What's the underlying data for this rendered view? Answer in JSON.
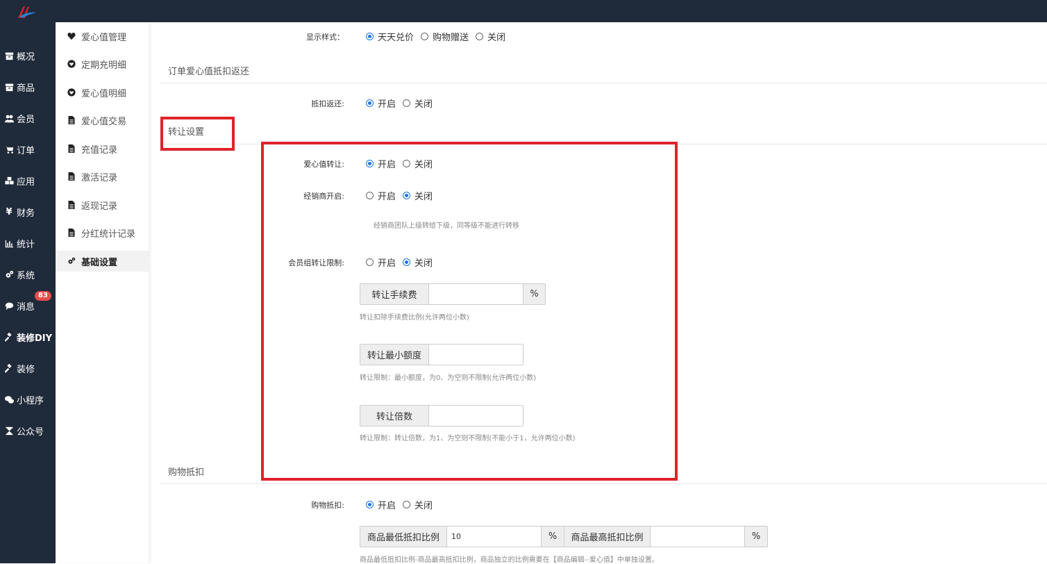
{
  "nav": {
    "items": [
      {
        "label": "概况",
        "icon": "archive-icon"
      },
      {
        "label": "商品",
        "icon": "archive-icon"
      },
      {
        "label": "会员",
        "icon": "users-icon"
      },
      {
        "label": "订单",
        "icon": "cart-icon"
      },
      {
        "label": "应用",
        "icon": "cubes-icon"
      },
      {
        "label": "财务",
        "icon": "yen-icon"
      },
      {
        "label": "统计",
        "icon": "bar-chart-icon"
      },
      {
        "label": "系统",
        "icon": "gears-icon"
      },
      {
        "label": "消息",
        "icon": "chat-icon",
        "badge": "83"
      },
      {
        "label": "装修DIY",
        "icon": "gavel-icon"
      },
      {
        "label": "装修",
        "icon": "gavel-icon"
      },
      {
        "label": "小程序",
        "icon": "wechat-icon"
      },
      {
        "label": "公众号",
        "icon": "hourglass-icon"
      }
    ]
  },
  "submenu": {
    "items": [
      {
        "label": "爱心值管理",
        "icon": "heart-icon"
      },
      {
        "label": "定期充明细",
        "icon": "heart-circle-icon"
      },
      {
        "label": "爱心值明细",
        "icon": "heart-circle-icon"
      },
      {
        "label": "爱心值交易",
        "icon": "file-icon"
      },
      {
        "label": "充值记录",
        "icon": "file-icon"
      },
      {
        "label": "激活记录",
        "icon": "file-icon"
      },
      {
        "label": "返现记录",
        "icon": "file-icon"
      },
      {
        "label": "分红统计记录",
        "icon": "file-icon"
      },
      {
        "label": "基础设置",
        "icon": "gears-icon",
        "active": true
      }
    ]
  },
  "display_style": {
    "label": "显示样式：",
    "options": [
      "天天兑价",
      "购物赠送",
      "关闭"
    ],
    "selected": "天天兑价"
  },
  "order_section": {
    "title": "订单爱心值抵扣返还",
    "deduct_return": {
      "label": "抵扣返还:",
      "options": [
        "开启",
        "关闭"
      ],
      "selected": "开启"
    }
  },
  "transfer_section": {
    "title": "转让设置",
    "love_transfer": {
      "label": "爱心值转让:",
      "options": [
        "开启",
        "关闭"
      ],
      "selected": "开启"
    },
    "dealer_open": {
      "label": "经销商开启:",
      "options": [
        "开启",
        "关闭"
      ],
      "selected": "关闭"
    },
    "dealer_help": "经销商团队上级转给下级，同等级不能进行转移",
    "member_group_limit": {
      "label": "会员组转让限制:",
      "options": [
        "开启",
        "关闭"
      ],
      "selected": "关闭"
    },
    "fee": {
      "label": "转让手续费",
      "value": "",
      "suffix": "%",
      "help": "转让扣除手续费比例(允许两位小数)"
    },
    "min_amount": {
      "label": "转让最小额度",
      "value": "",
      "help": "转让限制：最小额度，为0、为空则不限制(允许两位小数)"
    },
    "multiple": {
      "label": "转让倍数",
      "value": "",
      "help": "转让限制：转让倍数，为1、为空则不限制(不能小于1，允许两位小数)"
    }
  },
  "shopping_section": {
    "title": "购物抵扣",
    "shopping_deduct": {
      "label": "购物抵扣:",
      "options": [
        "开启",
        "关闭"
      ],
      "selected": "开启"
    },
    "min_ratio": {
      "label": "商品最低抵扣比例",
      "value": "10",
      "suffix": "%"
    },
    "max_ratio": {
      "label": "商品最高抵扣比例",
      "value": "",
      "suffix": "%"
    },
    "help": "商品最低抵扣比例-商品最高抵扣比例，商品独立的比例需要在【商品编辑--爱心值】中单独设置。"
  },
  "colors": {
    "nav_bg": "#1f2a3a",
    "accent": "#1a73e8",
    "highlight": "#e0222c",
    "badge": "#e54d4d"
  }
}
